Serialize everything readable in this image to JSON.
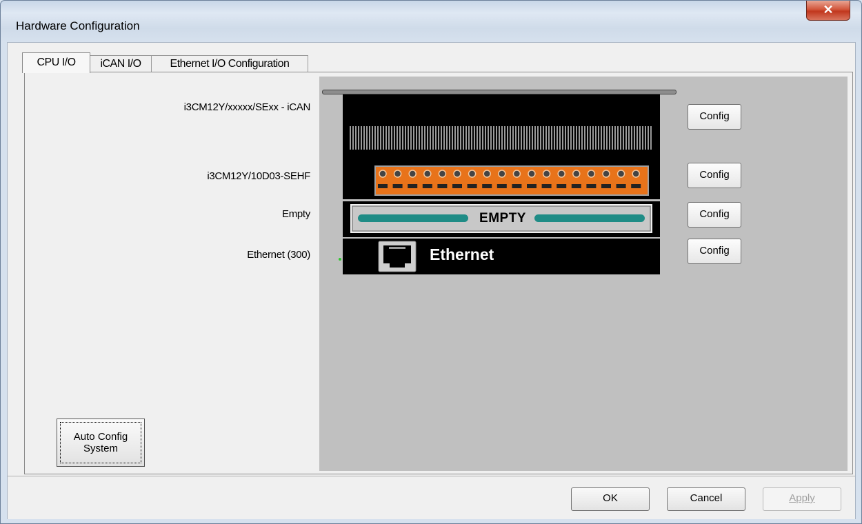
{
  "window": {
    "title": "Hardware Configuration",
    "close_glyph": "✕"
  },
  "tabs": [
    {
      "label": "CPU I/O",
      "active": true
    },
    {
      "label": "iCAN I/O",
      "active": false
    },
    {
      "label": "Ethernet I/O Configuration",
      "active": false
    }
  ],
  "slots": [
    {
      "label": "i3CM12Y/xxxxx/SExx - iCAN",
      "config": "Config"
    },
    {
      "label": "i3CM12Y/10D03-SEHF",
      "config": "Config"
    },
    {
      "label": "Empty",
      "config": "Config",
      "module_text": "EMPTY"
    },
    {
      "label": "Ethernet (300)",
      "config": "Config",
      "module_text": "Ethernet"
    }
  ],
  "auto_config": {
    "line1": "Auto Config",
    "line2": "System"
  },
  "buttons": {
    "ok": "OK",
    "cancel": "Cancel",
    "apply": "Apply"
  },
  "colors": {
    "terminal_orange": "#e8731a",
    "empty_teal": "#1f8c86",
    "rack_bg": "#c0c0c0"
  },
  "icons": [
    "close-icon",
    "rj45-port-icon"
  ]
}
